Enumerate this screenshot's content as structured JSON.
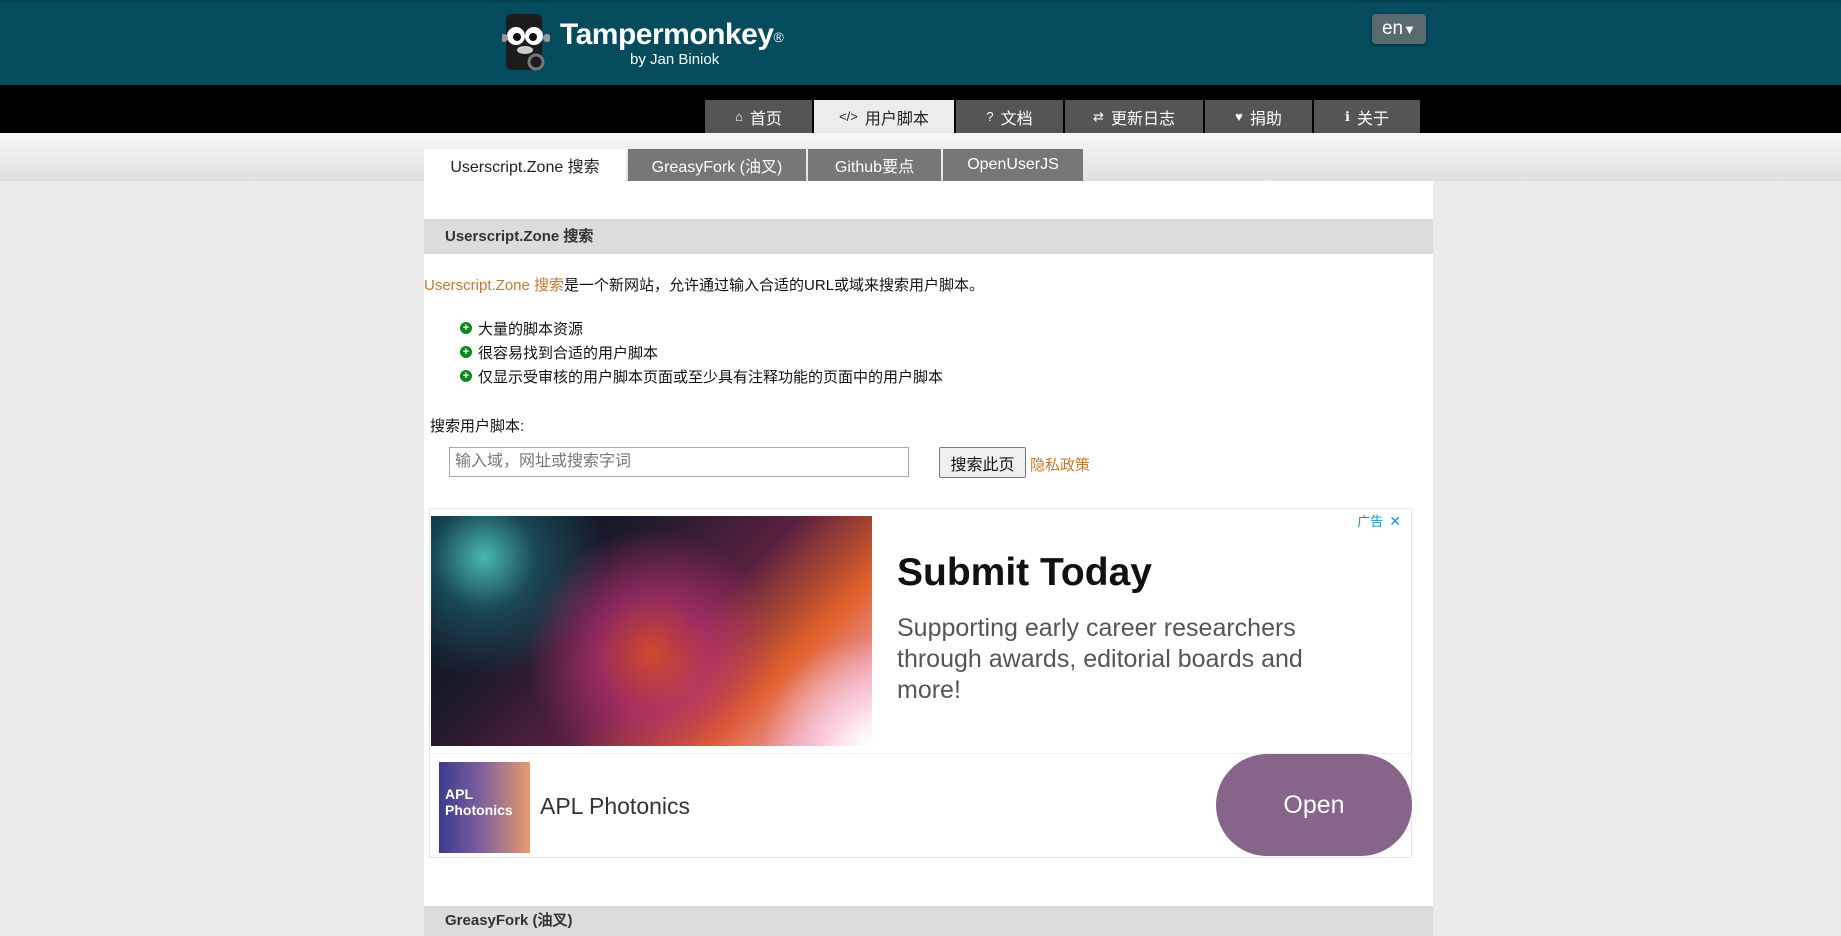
{
  "header": {
    "brand": "Tampermonkey",
    "registered": "®",
    "byline": "by Jan Biniok",
    "language": "en"
  },
  "nav": {
    "items": [
      {
        "label": "首页",
        "icon": "home-icon",
        "glyph": "⌂"
      },
      {
        "label": "用户脚本",
        "icon": "code-icon",
        "glyph": "</>",
        "active": true
      },
      {
        "label": "文档",
        "icon": "question-icon",
        "glyph": "?"
      },
      {
        "label": "更新日志",
        "icon": "exchange-icon",
        "glyph": "⇄"
      },
      {
        "label": "捐助",
        "icon": "heart-icon",
        "glyph": "♥"
      },
      {
        "label": "关于",
        "icon": "info-icon",
        "glyph": "ℹ"
      }
    ]
  },
  "tabs": [
    {
      "label": "Userscript.Zone 搜索",
      "active": true
    },
    {
      "label": "GreasyFork (油叉)"
    },
    {
      "label": "Github要点"
    },
    {
      "label": "OpenUserJS"
    }
  ],
  "section": {
    "title": "Userscript.Zone 搜索",
    "intro_link": "Userscript.Zone 搜索",
    "intro_text": "是一个新网站，允许通过输入合适的URL或域来搜索用户脚本。",
    "features": [
      "大量的脚本资源",
      "很容易找到合适的用户脚本",
      "仅显示受审核的用户脚本页面或至少具有注释功能的页面中的用户脚本"
    ],
    "search_label": "搜索用户脚本:",
    "search_placeholder": "输入域，网址或搜索字词",
    "search_value": "",
    "search_button": "搜索此页",
    "privacy_link": "隐私政策"
  },
  "ad": {
    "label": "广告",
    "close": "✕",
    "title": "Submit Today",
    "description": "Supporting early career researchers through awards, editorial boards and more!",
    "brand_logo_text": "APL Photonics",
    "brand_name": "APL Photonics",
    "cta": "Open"
  },
  "next_section": {
    "title": "GreasyFork (油叉)"
  },
  "colors": {
    "header_bg": "#034b5d",
    "nav_bg": "#000000",
    "link": "#c8782c",
    "plus_icon": "#0a8a1a",
    "ad_cta": "#87648a"
  }
}
